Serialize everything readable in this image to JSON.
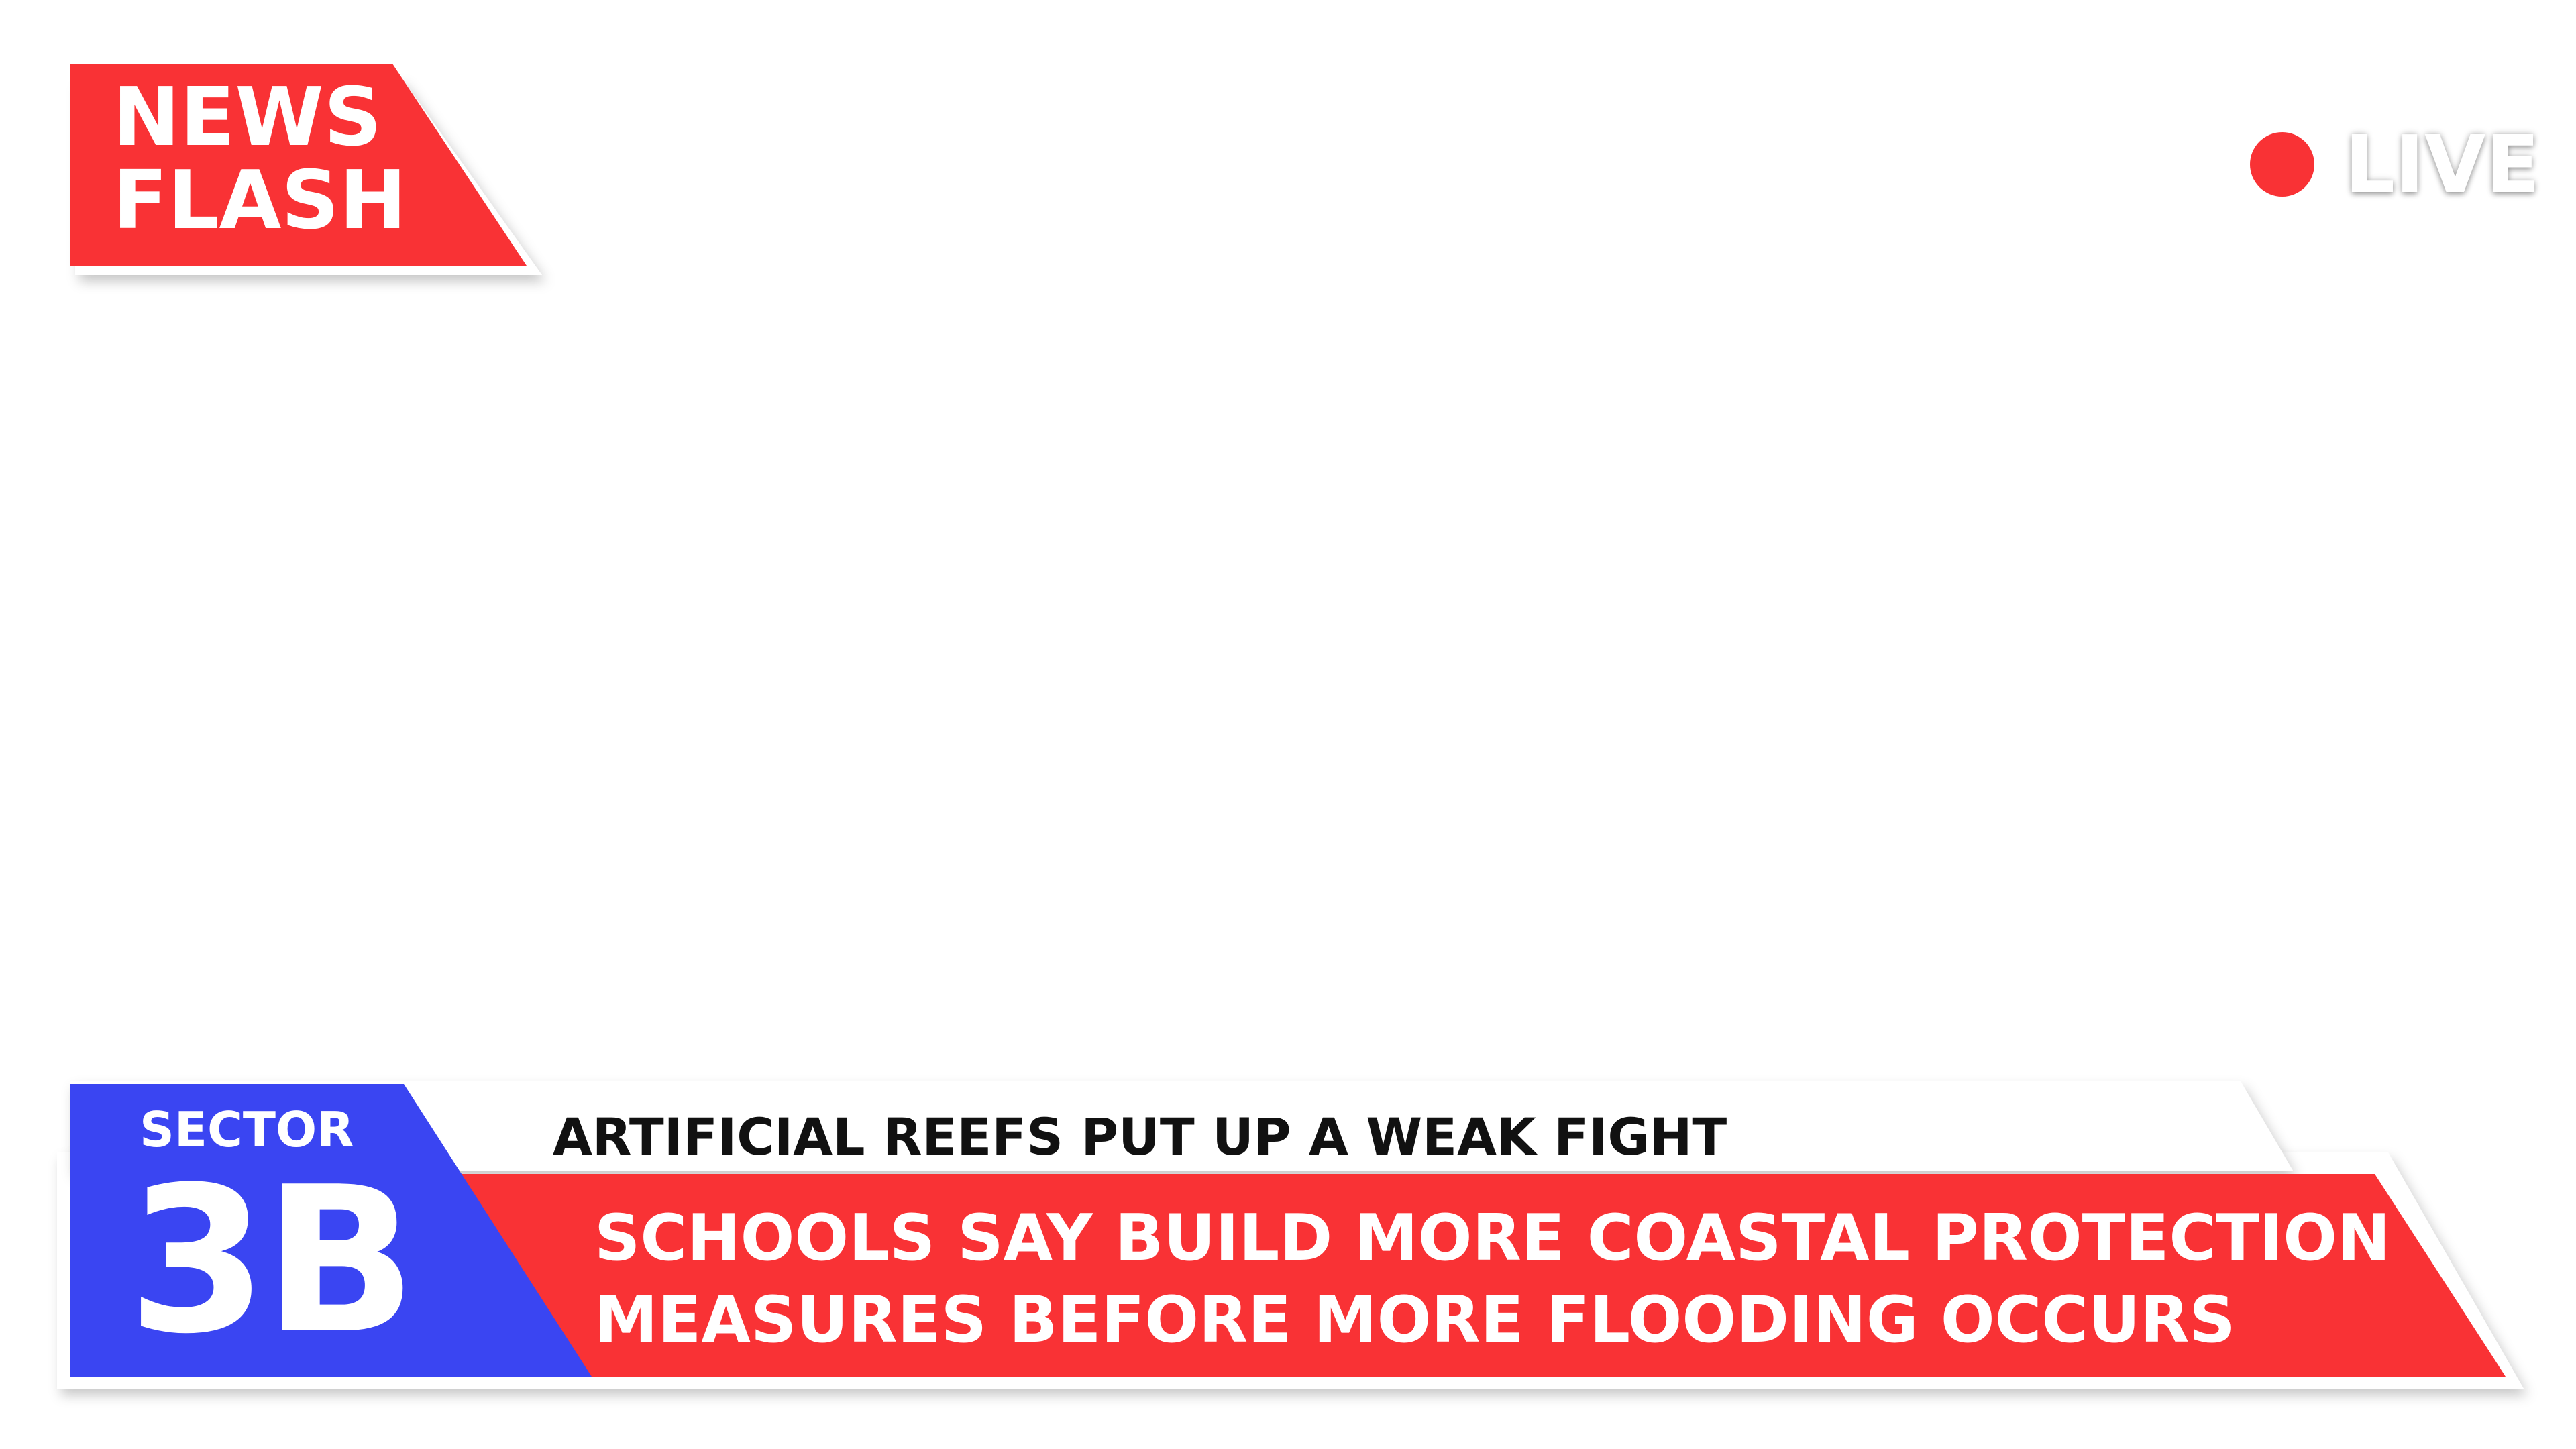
{
  "badge": {
    "line1": "NEWS",
    "line2": "FLASH"
  },
  "live": {
    "label": "LIVE"
  },
  "lower_third": {
    "sector_label": "SECTOR",
    "sector_code": "3B",
    "subheadline": "ARTIFICIAL REEFS PUT UP A WEAK FIGHT",
    "headline_line1": "SCHOOLS SAY BUILD MORE COASTAL PROTECTION",
    "headline_line2": "MEASURES BEFORE MORE FLOODING OCCURS"
  },
  "colors": {
    "red": "#f93235",
    "blue": "#3a45f2",
    "white": "#ffffff",
    "text_dark": "#111111"
  },
  "icons": {
    "live_indicator": "red-dot-icon"
  }
}
